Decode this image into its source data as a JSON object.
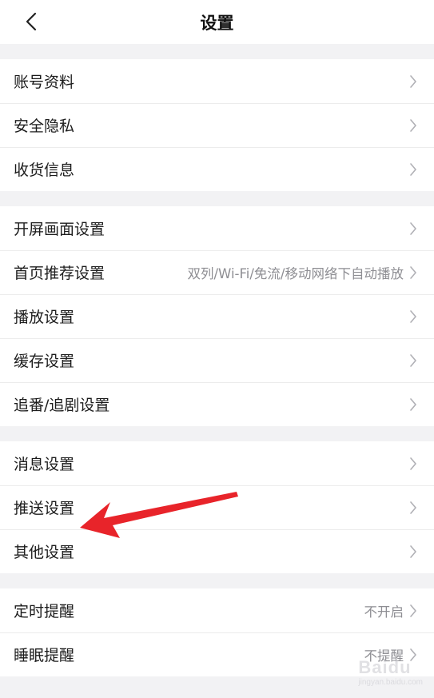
{
  "header": {
    "title": "设置"
  },
  "groups": [
    {
      "items": [
        {
          "label": "账号资料",
          "value": ""
        },
        {
          "label": "安全隐私",
          "value": ""
        },
        {
          "label": "收货信息",
          "value": ""
        }
      ]
    },
    {
      "items": [
        {
          "label": "开屏画面设置",
          "value": ""
        },
        {
          "label": "首页推荐设置",
          "value": "双列/Wi-Fi/免流/移动网络下自动播放"
        },
        {
          "label": "播放设置",
          "value": ""
        },
        {
          "label": "缓存设置",
          "value": ""
        },
        {
          "label": "追番/追剧设置",
          "value": ""
        }
      ]
    },
    {
      "items": [
        {
          "label": "消息设置",
          "value": ""
        },
        {
          "label": "推送设置",
          "value": ""
        },
        {
          "label": "其他设置",
          "value": ""
        }
      ]
    },
    {
      "items": [
        {
          "label": "定时提醒",
          "value": "不开启"
        },
        {
          "label": "睡眠提醒",
          "value": "不提醒"
        }
      ]
    }
  ],
  "annotation": {
    "arrow_color": "#e8242a"
  },
  "watermark": {
    "brand": "Baidu",
    "sub": "jingyan.baidu.com"
  },
  "colors": {
    "background": "#f2f2f4",
    "row": "#ffffff",
    "secondary_text": "#8e8e93",
    "chevron": "#b0b0b5"
  },
  "icons": {
    "back": "chevron-left-icon",
    "row_arrow": "chevron-right-icon"
  }
}
